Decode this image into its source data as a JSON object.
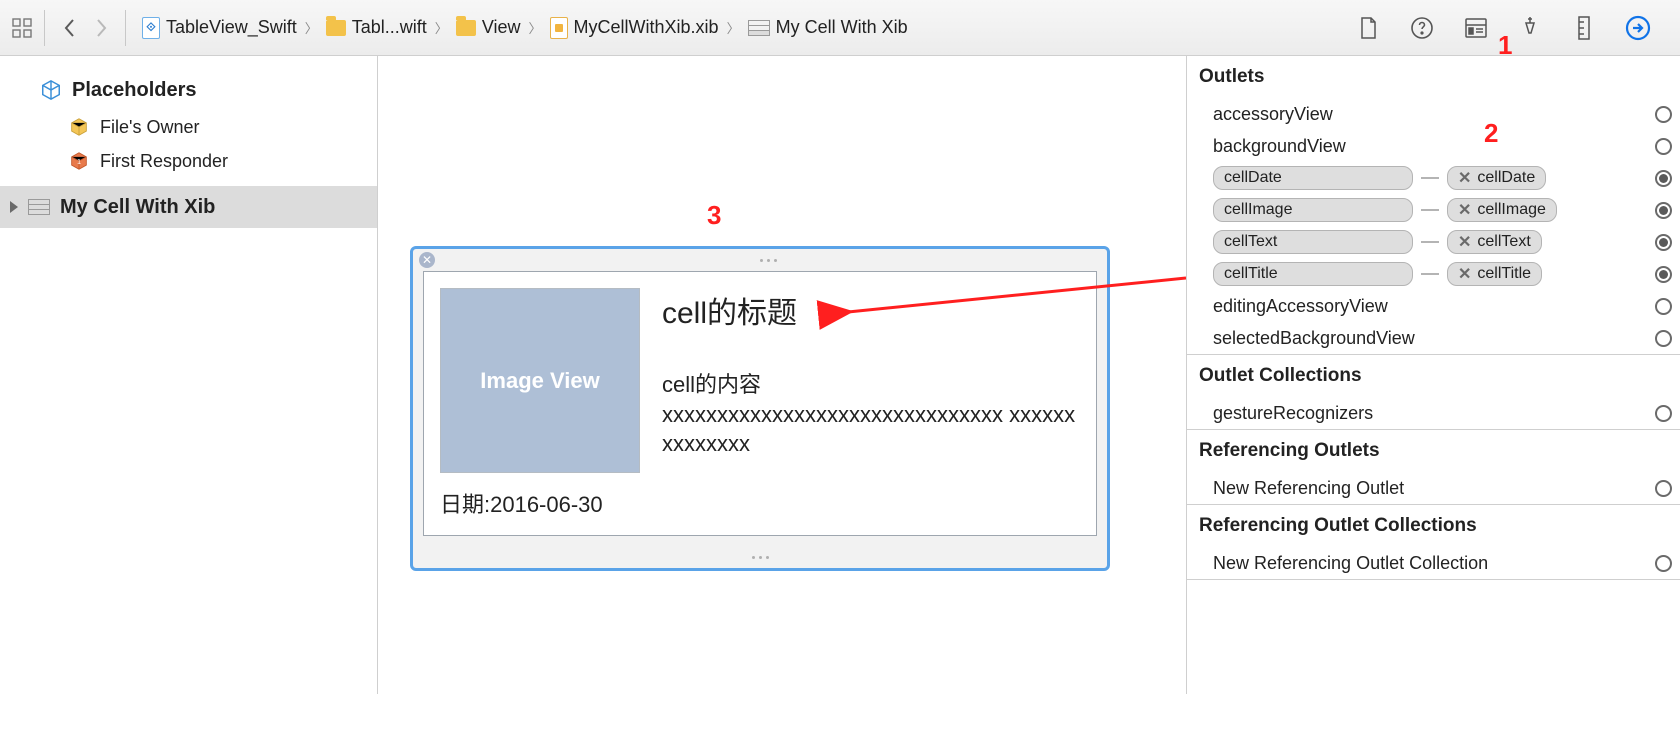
{
  "breadcrumbs": {
    "items": [
      {
        "label": "TableView_Swift"
      },
      {
        "label": "Tabl...wift"
      },
      {
        "label": "View"
      },
      {
        "label": "MyCellWithXib.xib"
      },
      {
        "label": "My Cell With Xib"
      }
    ]
  },
  "sidebar": {
    "placeholders_title": "Placeholders",
    "files_owner": "File's Owner",
    "first_responder": "First Responder",
    "selected": "My Cell With Xib"
  },
  "canvas": {
    "image_placeholder": "Image View",
    "cell_title": "cell的标题",
    "cell_text_label": "cell的内容",
    "cell_text_body": "xxxxxxxxxxxxxxxxxxxxxxxxxxxxxxx xxxxxxxxxxxxxx",
    "cell_date": "日期:2016-06-30"
  },
  "inspector": {
    "outlets_header": "Outlets",
    "outlets": [
      {
        "name": "accessoryView",
        "connected": false
      },
      {
        "name": "backgroundView",
        "connected": false
      },
      {
        "name": "cellDate",
        "connected": true,
        "target": "cellDate"
      },
      {
        "name": "cellImage",
        "connected": true,
        "target": "cellImage"
      },
      {
        "name": "cellText",
        "connected": true,
        "target": "cellText"
      },
      {
        "name": "cellTitle",
        "connected": true,
        "target": "cellTitle"
      },
      {
        "name": "editingAccessoryView",
        "connected": false
      },
      {
        "name": "selectedBackgroundView",
        "connected": false
      }
    ],
    "outlet_collections_header": "Outlet Collections",
    "outlet_collections": [
      {
        "name": "gestureRecognizers",
        "connected": false
      }
    ],
    "ref_outlets_header": "Referencing Outlets",
    "ref_outlets": [
      {
        "name": "New Referencing Outlet",
        "connected": false
      }
    ],
    "ref_collections_header": "Referencing Outlet Collections",
    "ref_collections": [
      {
        "name": "New Referencing Outlet Collection",
        "connected": false
      }
    ]
  },
  "annotations": {
    "a1": "1",
    "a2": "2",
    "a3": "3"
  }
}
